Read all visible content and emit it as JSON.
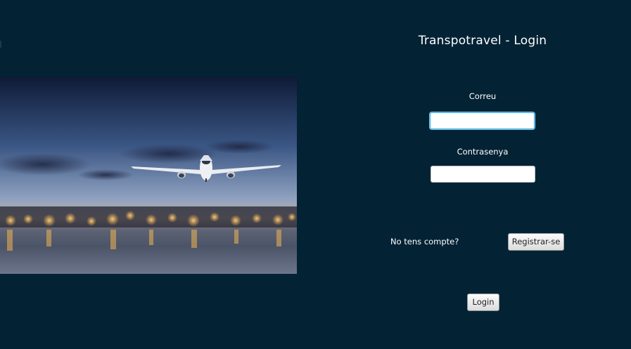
{
  "window": {
    "title": "Transpotravel - Login"
  },
  "hero": {
    "image": "airplane-over-city-lights"
  },
  "form": {
    "email_label": "Correu",
    "email_value": "",
    "password_label": "Contrasenya",
    "password_value": "",
    "no_account_text": "No tens compte?",
    "register_label": "Registrar-se",
    "login_label": "Login"
  },
  "colors": {
    "background": "#032335",
    "focus_ring": "#3aa7e0"
  }
}
